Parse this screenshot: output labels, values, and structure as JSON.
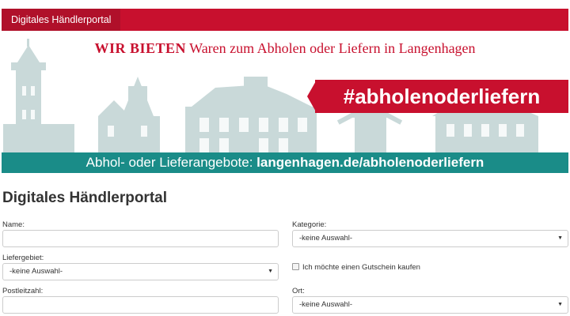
{
  "header": {
    "title": "Digitales Händlerportal"
  },
  "banner": {
    "headline_bold": "WIR BIETEN",
    "headline_rest": " Waren zum Abholen oder Liefern in Langenhagen",
    "hashtag": "#abholenoderliefern",
    "offer_prefix": "Abhol- oder Lieferangebote: ",
    "offer_url": "langenhagen.de/abholenoderliefern",
    "colors": {
      "red": "#c8102e",
      "teal": "#1a8c88",
      "silhouette": "#c9d9d9"
    }
  },
  "page": {
    "title": "Digitales Händlerportal"
  },
  "form": {
    "name_label": "Name:",
    "name_value": "",
    "category_label": "Kategorie:",
    "category_value": "-keine Auswahl-",
    "delivery_area_label": "Liefergebiet:",
    "delivery_area_value": "-keine Auswahl-",
    "voucher_label": "Ich möchte einen Gutschein kaufen",
    "postcode_label": "Postleitzahl:",
    "postcode_value": "",
    "location_label": "Ort:",
    "location_value": "-keine Auswahl-"
  }
}
